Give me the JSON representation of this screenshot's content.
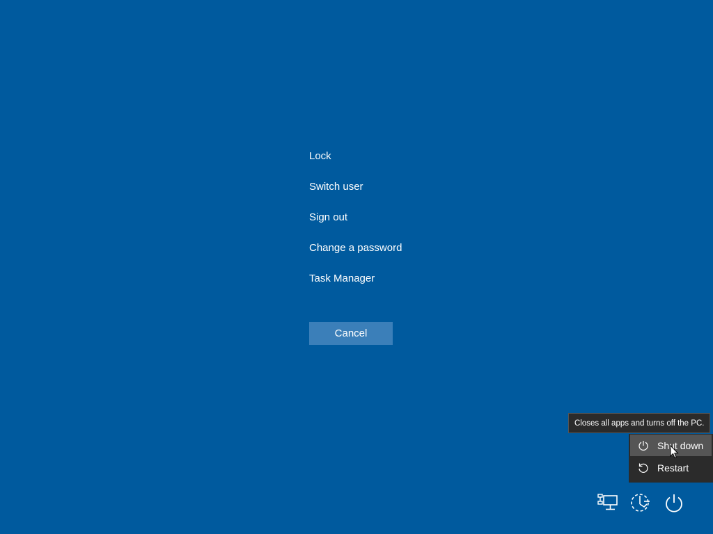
{
  "options": {
    "lock": "Lock",
    "switch_user": "Switch user",
    "sign_out": "Sign out",
    "change_password": "Change a password",
    "task_manager": "Task Manager"
  },
  "cancel_label": "Cancel",
  "tooltip": "Closes all apps and turns off the PC.",
  "power_menu": {
    "shut_down": "Shut down",
    "restart": "Restart"
  },
  "icons": {
    "network": "network-icon",
    "ease_of_access": "ease-of-access-icon",
    "power": "power-icon",
    "shut_down": "power-icon",
    "restart": "restart-icon"
  },
  "colors": {
    "background": "#005a9e",
    "button": "#3b7fb9",
    "menu": "#2b2b2b",
    "menu_hover": "#555555"
  }
}
